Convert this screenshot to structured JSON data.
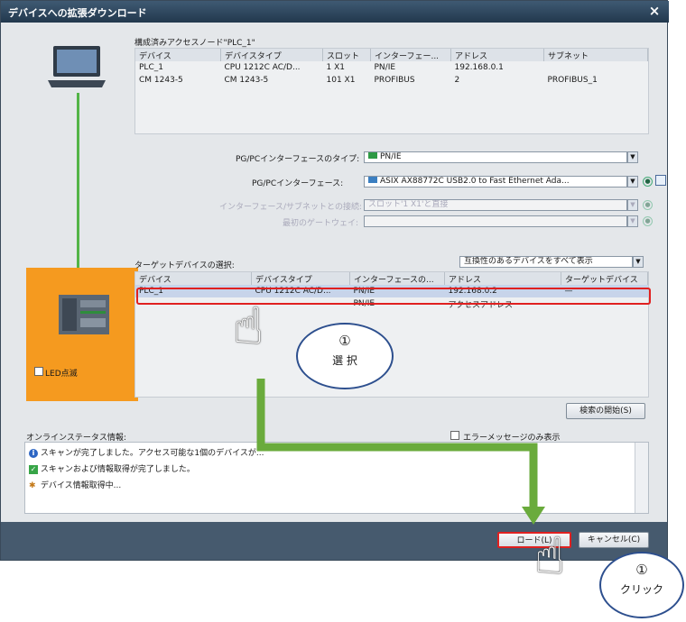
{
  "window": {
    "title": "デバイスへの拡張ダウンロード",
    "close": "×"
  },
  "config": {
    "heading": "構成済みアクセスノード\"PLC_1\"",
    "columns": [
      "デバイス",
      "デバイスタイプ",
      "スロット",
      "インターフェー...",
      "アドレス",
      "サブネット"
    ],
    "rows": [
      [
        "PLC_1",
        "CPU 1212C AC/D...",
        "1 X1",
        "PN/IE",
        "192.168.0.1",
        ""
      ],
      [
        "CM 1243-5",
        "CM 1243-5",
        "101 X1",
        "PROFIBUS",
        "2",
        "PROFIBUS_1"
      ]
    ]
  },
  "iface": {
    "type_label": "PG/PCインターフェースのタイプ:",
    "type_value": "PN/IE",
    "pgpc_label": "PG/PCインターフェース:",
    "pgpc_value": "ASIX AX88772C USB2.0 to Fast Ethernet Ada...",
    "conn_label": "インターフェース/サブネットとの接続:",
    "conn_value": "スロット'1 X1'と直接",
    "gateway_label": "最初のゲートウェイ:"
  },
  "target": {
    "label": "ターゲットデバイスの選択:",
    "filter": "互換性のあるデバイスをすべて表示",
    "columns": [
      "デバイス",
      "デバイスタイプ",
      "インターフェースの...",
      "アドレス",
      "ターゲットデバイス"
    ],
    "rows": [
      [
        "PLC_1",
        "CPU 1212C AC/D...",
        "PN/IE",
        "192.168.0.2",
        "—"
      ],
      [
        "—",
        "—",
        "PN/IE",
        "アクセスアドレス",
        "—"
      ]
    ]
  },
  "led": {
    "label": "LED点滅"
  },
  "search_button": "検索の開始(S)",
  "status": {
    "label": "オンラインステータス情報:",
    "errors_only": "エラーメッセージのみ表示",
    "lines": [
      "スキャンが完了しました。アクセス可能な1個のデバイスが...",
      "スキャンおよび情報取得が完了しました。",
      "デバイス情報取得中..."
    ]
  },
  "buttons": {
    "load": "ロード(L)",
    "cancel": "キャンセル(C)"
  },
  "callouts": {
    "select_num": "①",
    "select_text": "選 択",
    "click_num": "①",
    "click_text": "クリック"
  },
  "colors": {
    "accent_red": "#e02020",
    "green_arrow": "#6aab3c",
    "orange": "#f59a1f",
    "titlebar": "#2c4459"
  },
  "icons": [
    "laptop-icon",
    "plc-icon",
    "info-icon",
    "check-icon",
    "loading-icon",
    "hand-pointer-icon"
  ]
}
